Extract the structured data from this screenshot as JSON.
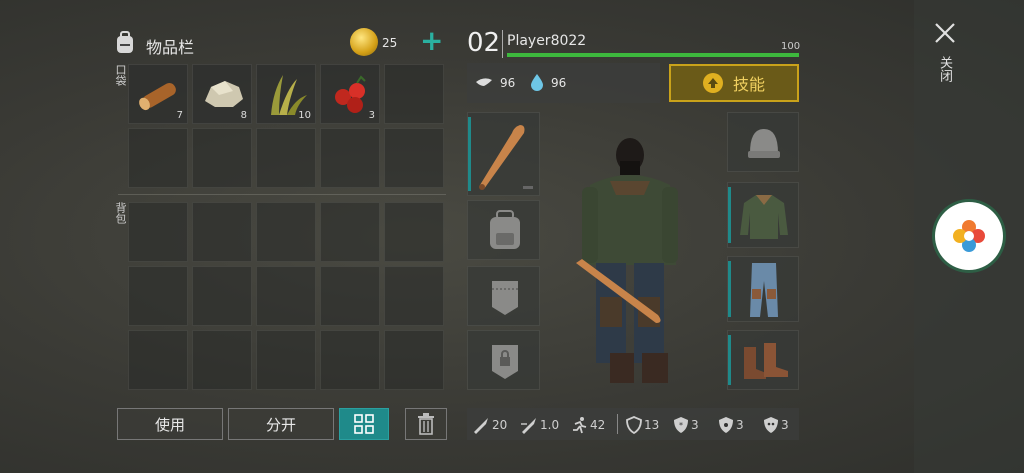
{
  "inventory": {
    "title": "物品栏",
    "coins": "25",
    "pocket_label": "口袋",
    "backpack_label": "背包",
    "items": [
      {
        "name": "log",
        "count": "7"
      },
      {
        "name": "stone",
        "count": "8"
      },
      {
        "name": "plant-fiber",
        "count": "10"
      },
      {
        "name": "berries",
        "count": "3"
      }
    ]
  },
  "player": {
    "level": "02",
    "name": "Player8022",
    "health": "100",
    "health_fraction": 1.0,
    "hunger": "96",
    "thirst": "96",
    "skills_label": "技能"
  },
  "actions": {
    "use": "使用",
    "split": "分开"
  },
  "stats": {
    "damage": "20",
    "speed": "1.0",
    "move": "42",
    "armor": "13",
    "cold": "3",
    "radiation": "3",
    "poison": "3"
  },
  "side": {
    "close_label": "关闭"
  },
  "colors": {
    "accent": "#c9a21a",
    "teal": "#1f8a8a",
    "health": "#3db83d"
  }
}
